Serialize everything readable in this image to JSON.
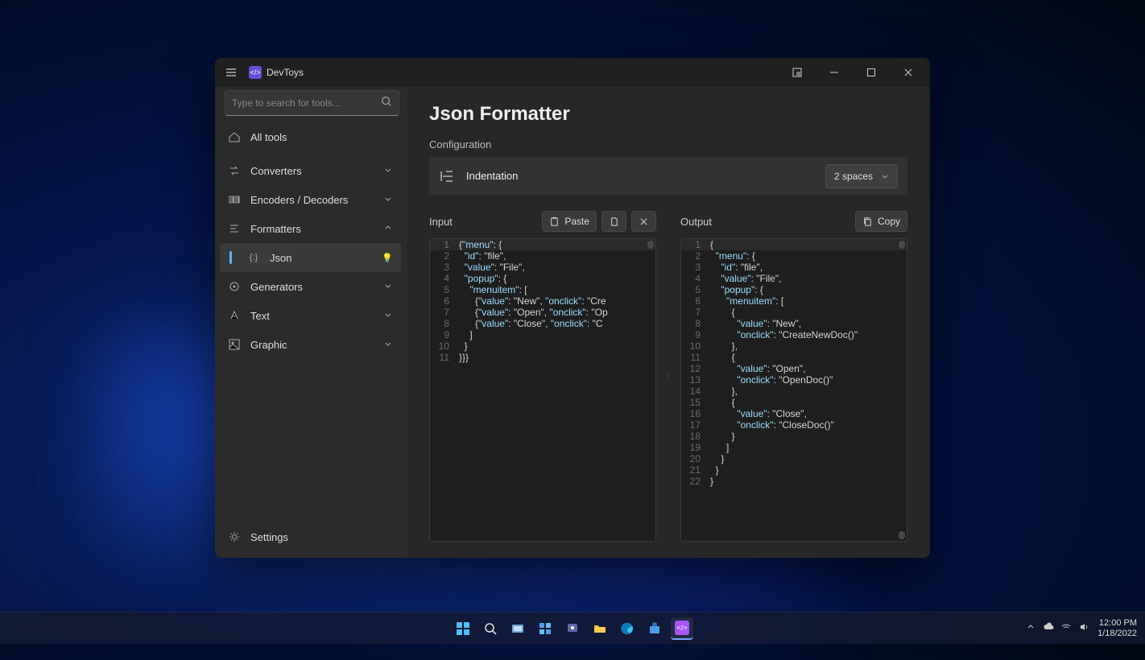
{
  "app": {
    "title": "DevToys"
  },
  "search": {
    "placeholder": "Type to search for tools..."
  },
  "sidebar": {
    "all_tools": "All tools",
    "groups": [
      {
        "label": "Converters"
      },
      {
        "label": "Encoders / Decoders"
      },
      {
        "label": "Formatters",
        "expanded": true
      },
      {
        "label": "Generators"
      },
      {
        "label": "Text"
      },
      {
        "label": "Graphic"
      }
    ],
    "json_item": {
      "label": "Json",
      "symbol": "{:}"
    },
    "settings": "Settings"
  },
  "page": {
    "title": "Json Formatter",
    "config_section": "Configuration",
    "indentation_label": "Indentation",
    "indentation_value": "2 spaces",
    "input_label": "Input",
    "output_label": "Output",
    "paste_btn": "Paste",
    "copy_btn": "Copy"
  },
  "input_code": [
    "{\"menu\": {",
    "  \"id\": \"file\",",
    "  \"value\": \"File\",",
    "  \"popup\": {",
    "    \"menuitem\": [",
    "      {\"value\": \"New\", \"onclick\": \"Cre",
    "      {\"value\": \"Open\", \"onclick\": \"Op",
    "      {\"value\": \"Close\", \"onclick\": \"C",
    "    ]",
    "  }",
    "}}}"
  ],
  "output_code": [
    "{",
    "  \"menu\": {",
    "    \"id\": \"file\",",
    "    \"value\": \"File\",",
    "    \"popup\": {",
    "      \"menuitem\": [",
    "        {",
    "          \"value\": \"New\",",
    "          \"onclick\": \"CreateNewDoc()\"",
    "        },",
    "        {",
    "          \"value\": \"Open\",",
    "          \"onclick\": \"OpenDoc()\"",
    "        },",
    "        {",
    "          \"value\": \"Close\",",
    "          \"onclick\": \"CloseDoc()\"",
    "        }",
    "      ]",
    "    }",
    "  }",
    "}"
  ],
  "taskbar": {
    "time": "12:00 PM",
    "date": "1/18/2022"
  }
}
